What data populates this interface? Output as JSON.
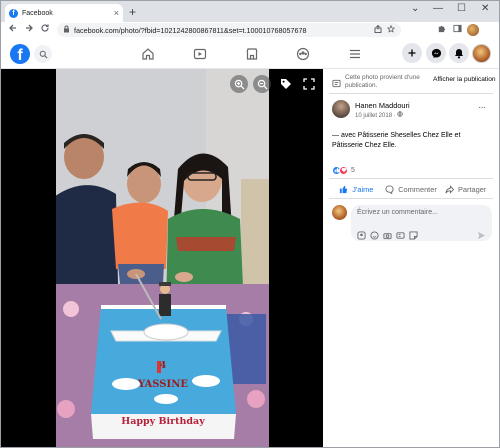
{
  "browser": {
    "tab_title": "Facebook",
    "favicon": "f",
    "tab_close": "×",
    "new_tab": "+",
    "window_controls": [
      "⌄",
      "—",
      "☐",
      "✕"
    ],
    "url": "facebook.com/photo/?fbid=1021242800867811&set=t.100010768057678",
    "icons": [
      "back-icon",
      "forward-icon",
      "reload-icon",
      "lock-icon",
      "share-icon",
      "star-icon",
      "puzzle-icon",
      "sidebar-icon"
    ]
  },
  "fb_header": {
    "logo": "f",
    "accent": "#1877f2",
    "nav_icons": [
      "home-icon",
      "watch-icon",
      "marketplace-icon",
      "groups-icon",
      "menu-icon"
    ],
    "right_icons": [
      "create-icon",
      "messenger-icon",
      "notifications-icon"
    ]
  },
  "viewer": {
    "tools": [
      "zoom-in-icon",
      "zoom-out-icon",
      "tag-icon",
      "fullscreen-icon"
    ],
    "cake_text": {
      "name": "YASSINE",
      "age": "4",
      "greeting": "Happy Birthday"
    }
  },
  "panel": {
    "notice_text": "Cette photo provient d'une publication.",
    "notice_button": "Afficher la publication",
    "author_name": "Hanen Maddouri",
    "post_date": "10 juillet 2018 ·",
    "more_dots": "···",
    "caption": "— avec Pâtisserie Sheselles Chez Elle et Pâtisserie Chez Elle.",
    "reaction_count": "5",
    "like_label": "J'aime",
    "comment_label": "Commenter",
    "share_label": "Partager",
    "comment_placeholder": "Écrivez un commentaire..."
  }
}
